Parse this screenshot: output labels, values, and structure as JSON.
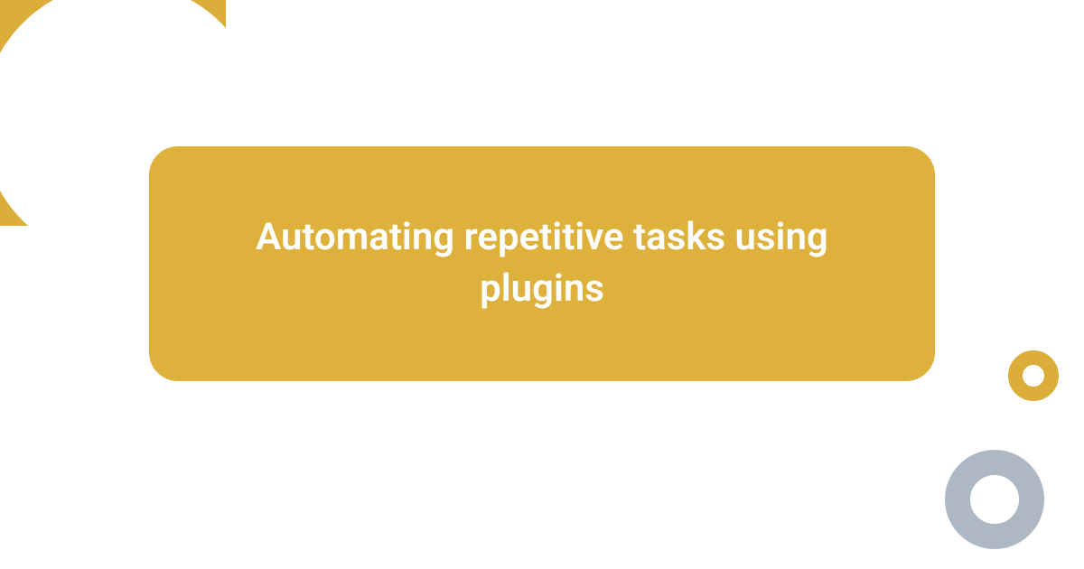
{
  "card": {
    "title": "Automating repetitive tasks using plugins"
  },
  "colors": {
    "accent": "#deb13d",
    "ring_gray": "#aeb8c2"
  }
}
